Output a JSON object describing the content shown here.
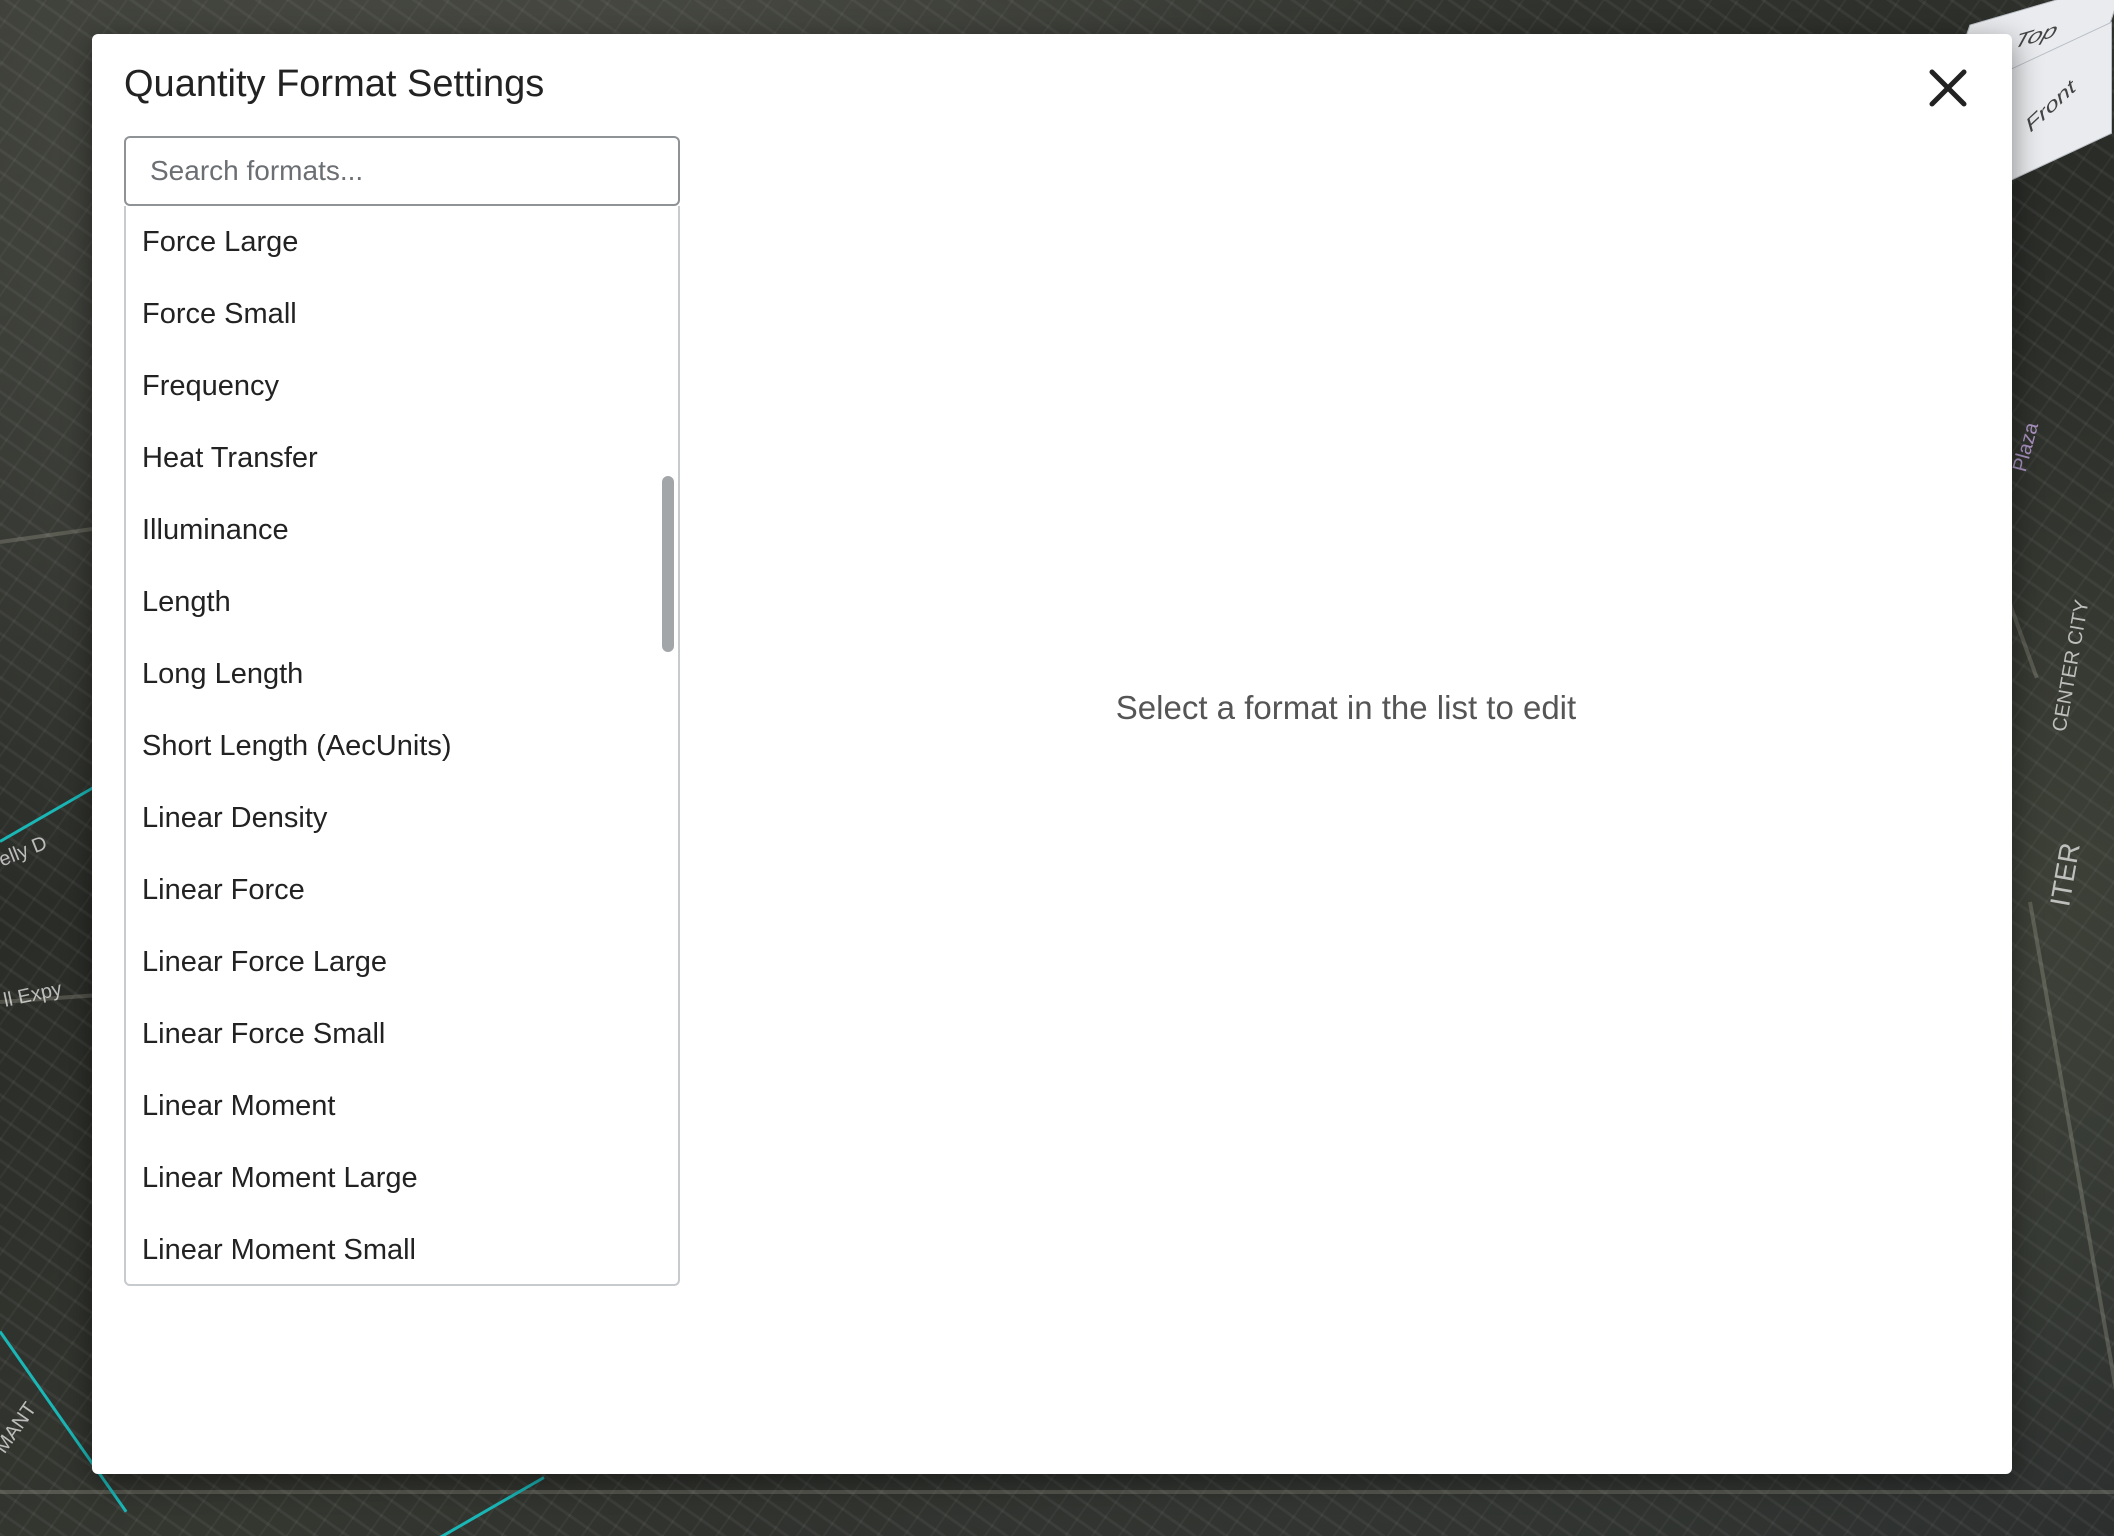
{
  "view_cube": {
    "top_label": "Top",
    "front_label": "Front"
  },
  "dialog": {
    "title": "Quantity Format Settings",
    "close_icon": "close-icon",
    "search": {
      "placeholder": "Search formats...",
      "value": ""
    },
    "formats": [
      "Force Large",
      "Force Small",
      "Frequency",
      "Heat Transfer",
      "Illuminance",
      "Length",
      "Long Length",
      "Short Length (AecUnits)",
      "Linear Density",
      "Linear Force",
      "Linear Force Large",
      "Linear Force Small",
      "Linear Moment",
      "Linear Moment Large",
      "Linear Moment Small"
    ],
    "empty_message": "Select a format in the list to edit"
  }
}
